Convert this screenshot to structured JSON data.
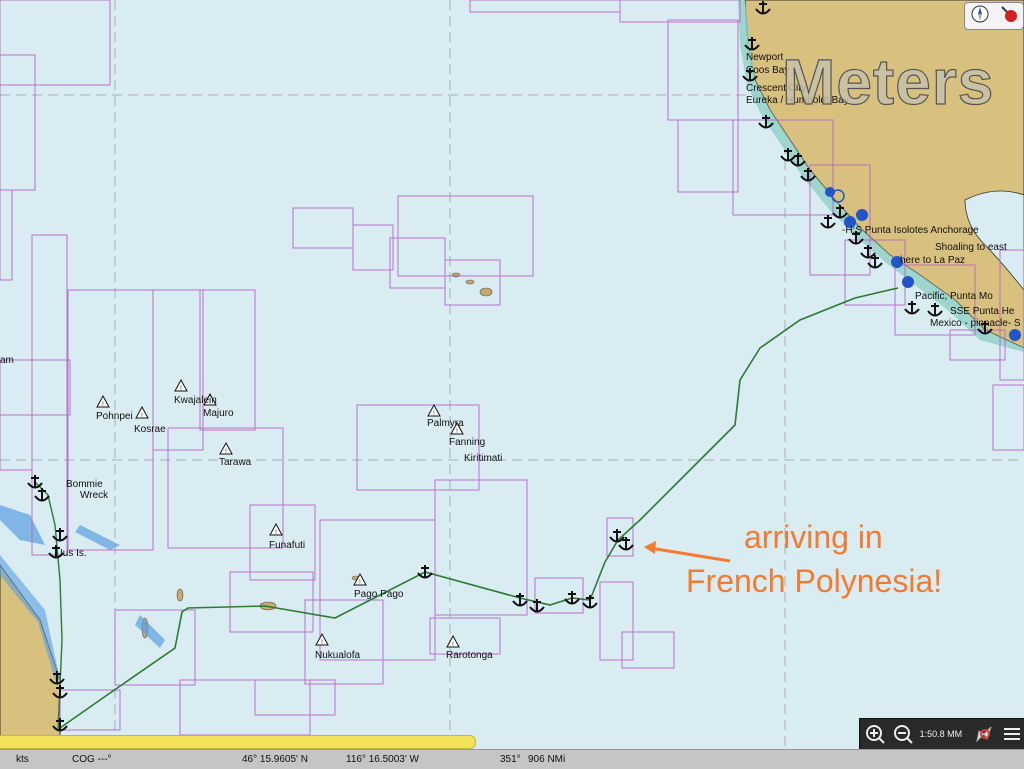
{
  "watermark": "Meters",
  "annotation": {
    "line1": "arriving in",
    "line2": "French Polynesia!"
  },
  "places": [
    {
      "name": "Newport"
    },
    {
      "name": "Coos Bay"
    },
    {
      "name": "Crescent City"
    },
    {
      "name": "Eureka / Humboldt Bay"
    },
    {
      "name": "-H;S Punta Isolotes Anchorage"
    },
    {
      "name": "Shoaling to east"
    },
    {
      "name": "here to La Paz"
    },
    {
      "name": "Pacific, Punta Mo"
    },
    {
      "name": "SSE Punta He"
    },
    {
      "name": "Mexico - pinnacle- S"
    },
    {
      "name": "Kwajalein"
    },
    {
      "name": "Majuro"
    },
    {
      "name": "Pohnpei"
    },
    {
      "name": "Kosrae"
    },
    {
      "name": "Tarawa"
    },
    {
      "name": "Palmyra"
    },
    {
      "name": "Fanning"
    },
    {
      "name": "Kiritimati"
    },
    {
      "name": "Funafuti"
    },
    {
      "name": "Pago Pago"
    },
    {
      "name": "Nukualofa"
    },
    {
      "name": "Rarotonga"
    },
    {
      "name": "Bommie"
    },
    {
      "name": "Wreck"
    },
    {
      "name": "Ius Is."
    },
    {
      "name": "am"
    }
  ],
  "status": {
    "speed_unit": "kts",
    "cog": "COG ---°",
    "latitude": "46° 15.9605' N",
    "longitude": "116° 16.5003' W",
    "bearing": "351°",
    "distance": "906 NMi",
    "progress": 0.46
  },
  "toolbar": {
    "zoom_in_icon": "zoom-in-icon",
    "zoom_out_icon": "zoom-out-icon",
    "scale": "1:50.8 MM",
    "rocket_icon": "route-rocket-icon",
    "menu_icon": "menu-icon"
  },
  "colors": {
    "water": "#d9ecf2",
    "land": "#d8c07e",
    "chart_border": "#b964c8",
    "route": "#2d7a35",
    "annotation": "#f47a30"
  }
}
